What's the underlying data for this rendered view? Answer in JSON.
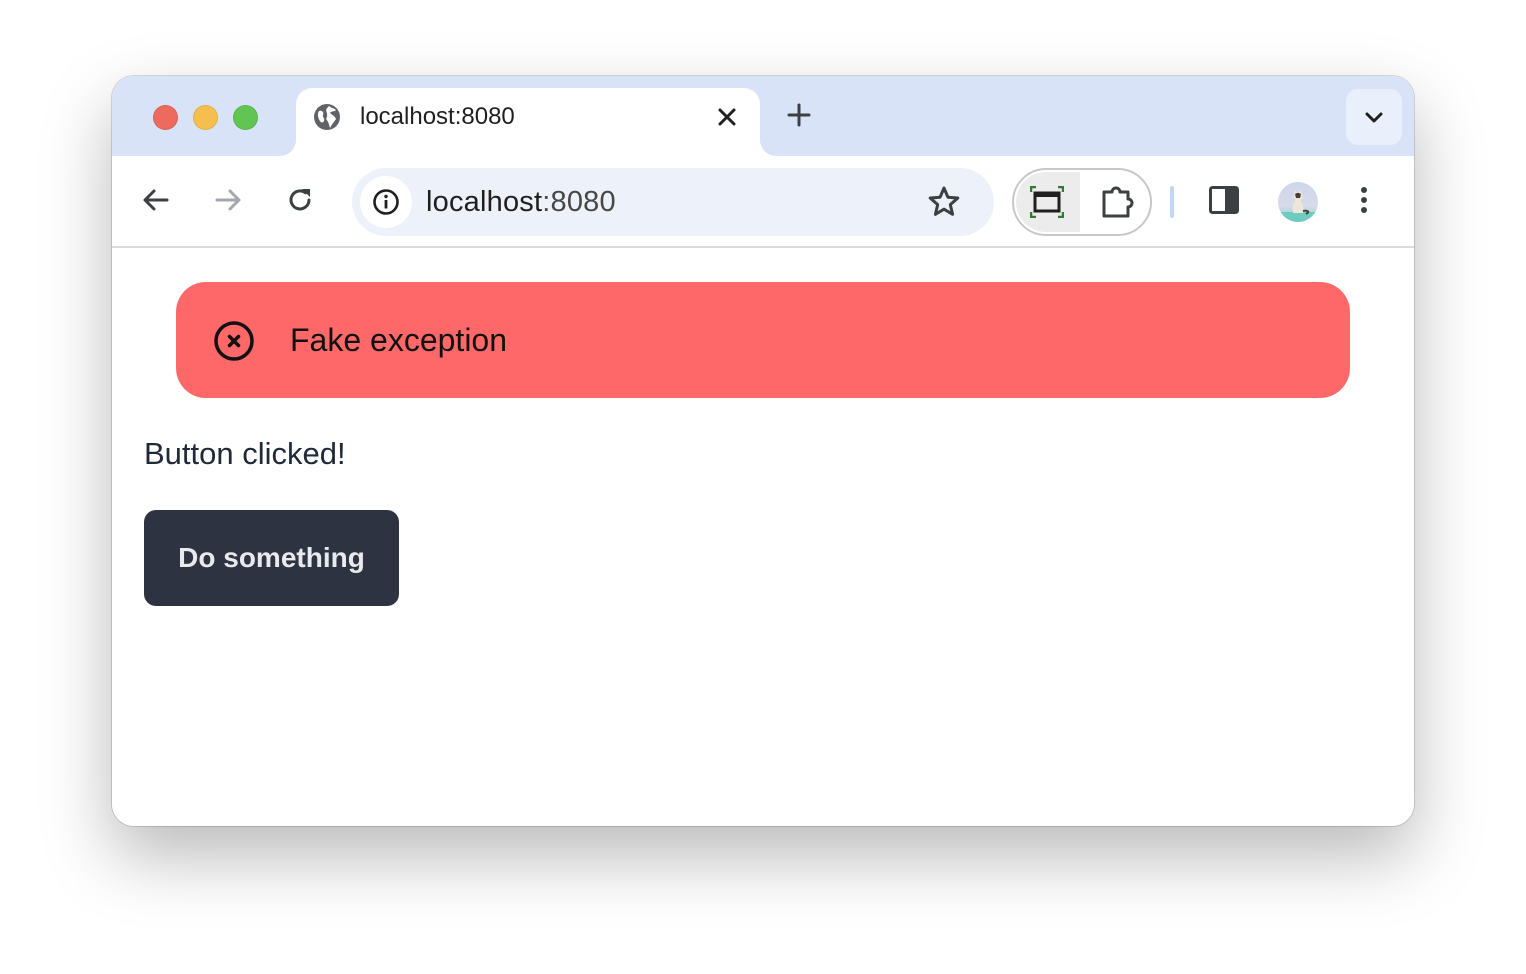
{
  "browser": {
    "tab": {
      "title": "localhost:8080",
      "favicon": "globe-icon",
      "close_icon": "close-icon"
    },
    "new_tab_icon": "plus-icon",
    "tab_search_icon": "chevron-down-icon",
    "toolbar": {
      "back_icon": "arrow-left-icon",
      "forward_icon": "arrow-right-icon",
      "reload_icon": "reload-icon",
      "site_info_icon": "info-icon",
      "url_host": "localhost",
      "url_port": ":8080",
      "bookmark_icon": "star-icon",
      "extension_icons": [
        "screenshot-capture-icon",
        "puzzle-icon"
      ],
      "side_panel_icon": "side-panel-icon",
      "profile_icon": "avatar",
      "menu_icon": "kebab-menu-icon"
    }
  },
  "page": {
    "alert": {
      "icon": "error-circle-icon",
      "message": "Fake exception",
      "color": "#fe6868"
    },
    "status_text": "Button clicked!",
    "button_label": "Do something",
    "button_color": "#2d3340"
  }
}
